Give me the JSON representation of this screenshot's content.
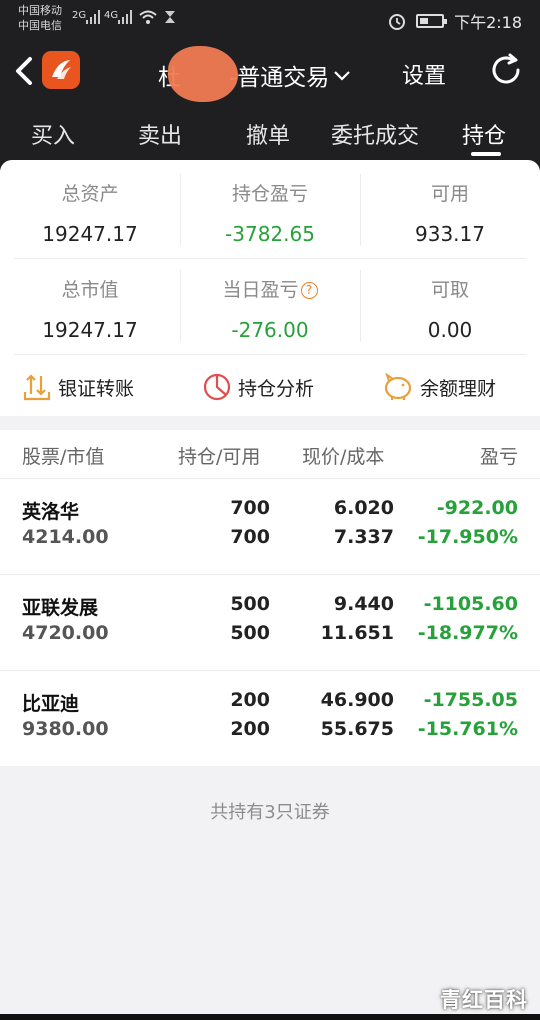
{
  "status_bar": {
    "carrier1": "中国移动",
    "carrier2": "中国电信",
    "net1": "2G",
    "net2": "4G",
    "time": "下午2:18"
  },
  "nav": {
    "account_title": "杜",
    "account_suffix": "-普通交易",
    "settings_label": "设置"
  },
  "tabs": [
    {
      "label": "买入"
    },
    {
      "label": "卖出"
    },
    {
      "label": "撤单"
    },
    {
      "label": "委托成交"
    },
    {
      "label": "持仓"
    }
  ],
  "summary": {
    "total_assets": {
      "label": "总资产",
      "value": "19247.17"
    },
    "position_pl": {
      "label": "持仓盈亏",
      "value": "-3782.65"
    },
    "available": {
      "label": "可用",
      "value": "933.17"
    },
    "market_value": {
      "label": "总市值",
      "value": "19247.17"
    },
    "daily_pl": {
      "label": "当日盈亏",
      "value": "-276.00"
    },
    "withdrawable": {
      "label": "可取",
      "value": "0.00"
    }
  },
  "actions": [
    {
      "label": "银证转账",
      "icon": "transfer-icon"
    },
    {
      "label": "持仓分析",
      "icon": "pie-chart-icon"
    },
    {
      "label": "余额理财",
      "icon": "piggy-bank-icon"
    }
  ],
  "holdings": {
    "headers": {
      "stock": "股票/市值",
      "position": "持仓/可用",
      "price": "现价/成本",
      "pl": "盈亏"
    },
    "rows": [
      {
        "name": "英洛华",
        "market_value": "4214.00",
        "position": "700",
        "available": "700",
        "price": "6.020",
        "cost": "7.337",
        "pl": "-922.00",
        "pl_pct": "-17.950%"
      },
      {
        "name": "亚联发展",
        "market_value": "4720.00",
        "position": "500",
        "available": "500",
        "price": "9.440",
        "cost": "11.651",
        "pl": "-1105.60",
        "pl_pct": "-18.977%"
      },
      {
        "name": "比亚迪",
        "market_value": "9380.00",
        "position": "200",
        "available": "200",
        "price": "46.900",
        "cost": "55.675",
        "pl": "-1755.05",
        "pl_pct": "-15.761%"
      }
    ],
    "footer": "共持有3只证券"
  },
  "watermark": "青红百科",
  "colors": {
    "header_bg": "#1f1f21",
    "loss_green": "#27a13a",
    "brand_orange": "#e8551f"
  }
}
